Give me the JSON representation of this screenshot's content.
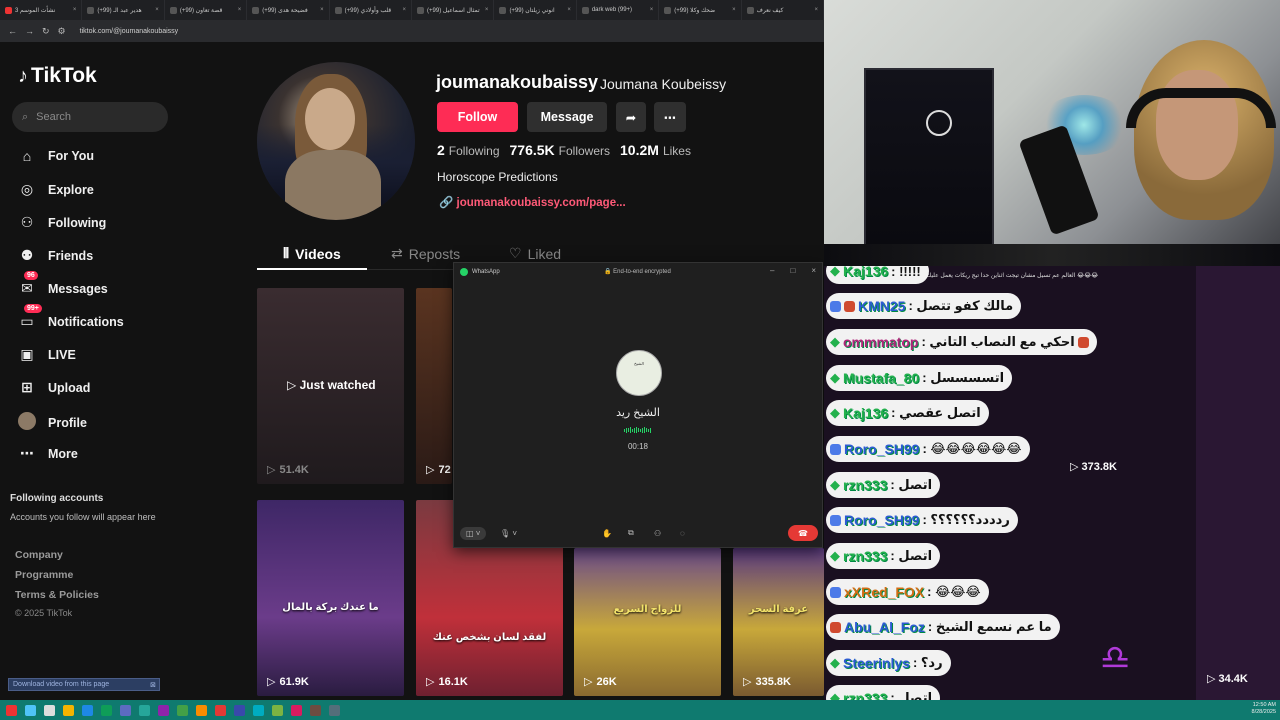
{
  "browser": {
    "tabs": [
      "نشأت الموسم 3",
      "هدير عبد الـ (99+)",
      "قصة تعاون (99+)",
      "فضيحة هدى (99+)",
      "قلب وأولادي (99+)",
      "تمثال اسماعيل (99+)",
      "انوني زيلتان (99+)",
      "dark web (99+)",
      "ضحك وكلا (99+)",
      "كيف نعرف"
    ],
    "url": "tiktok.com/@joumanakoubaissy"
  },
  "tiktok": {
    "logo": "TikTok",
    "search_placeholder": "Search",
    "nav": {
      "for_you": "For You",
      "explore": "Explore",
      "following": "Following",
      "friends": "Friends",
      "messages": "Messages",
      "messages_badge": "96",
      "notifications": "Notifications",
      "notifications_badge": "99+",
      "live": "LIVE",
      "upload": "Upload",
      "profile": "Profile",
      "more": "More"
    },
    "following_accounts": "Following accounts",
    "following_note": "Accounts you follow will appear here",
    "footer": {
      "company": "Company",
      "programme": "Programme",
      "terms": "Terms & Policies",
      "copyright": "© 2025 TikTok"
    },
    "download_bar": "Download video from this page"
  },
  "profile": {
    "username": "joumanakoubaissy",
    "display_name": "Joumana Koubeissy",
    "follow": "Follow",
    "message": "Message",
    "following_count": "2",
    "following_label": "Following",
    "followers_count": "776.5K",
    "followers_label": "Followers",
    "likes_count": "10.2M",
    "likes_label": "Likes",
    "bio": "Horoscope Predictions",
    "link": "joumanakoubaissy.com/page...",
    "tabs": {
      "videos": "Videos",
      "reposts": "Reposts",
      "liked": "Liked"
    },
    "just_watched": "Just watched",
    "views": [
      "51.4K",
      "72",
      "61.9K",
      "16.1K",
      "26K",
      "335.8K"
    ],
    "captions": [
      "ما عندك بركة بالمال",
      "لفقد لسان بشخص عنك",
      "للزواج السريع",
      "عرفة السحر"
    ]
  },
  "whatsapp": {
    "app": "WhatsApp",
    "encrypted": "End-to-end encrypted",
    "contact": "الشيخ ريد",
    "duration": "00:18",
    "avatar_text": "الشيخ"
  },
  "chat": {
    "top_line": "العالم عم تسيل مشان تيجت اثناين حدا تيج ريكات يعمل عليك فيديو 😂😂😂",
    "messages": [
      {
        "user": "Kaj136",
        "text": ": !!!!!"
      },
      {
        "user": "KMN25",
        "text": ": مالك كفو تتصل"
      },
      {
        "user": "ommmatop",
        "text": ": احكي مع النصاب التاني"
      },
      {
        "user": "Mustafa_80",
        "text": ": اتسسسسل"
      },
      {
        "user": "Kaj136",
        "text": ": اتصل عقصي"
      },
      {
        "user": "Roro_SH99",
        "text": ": 😂😂😂😂😂😂"
      },
      {
        "user": "rzn333",
        "text": ": اتصل"
      },
      {
        "user": "Roro_SH99",
        "text": ": ردددد؟؟؟؟؟؟"
      },
      {
        "user": "rzn333",
        "text": ": اتصل"
      },
      {
        "user": "xXRed_FOX",
        "text": ": 😂😂😂"
      },
      {
        "user": "Abu_Al_Foz",
        "text": ": ما عم نسمع الشيخ"
      },
      {
        "user": "Steerinlys",
        "text": ": رد؟"
      },
      {
        "user": "rzn333",
        "text": ": اتصل"
      }
    ],
    "side_views": [
      "373.8K",
      "34.4K"
    ]
  },
  "taskbar": {
    "time": "12:50 AM",
    "date": "8/28/2025"
  }
}
